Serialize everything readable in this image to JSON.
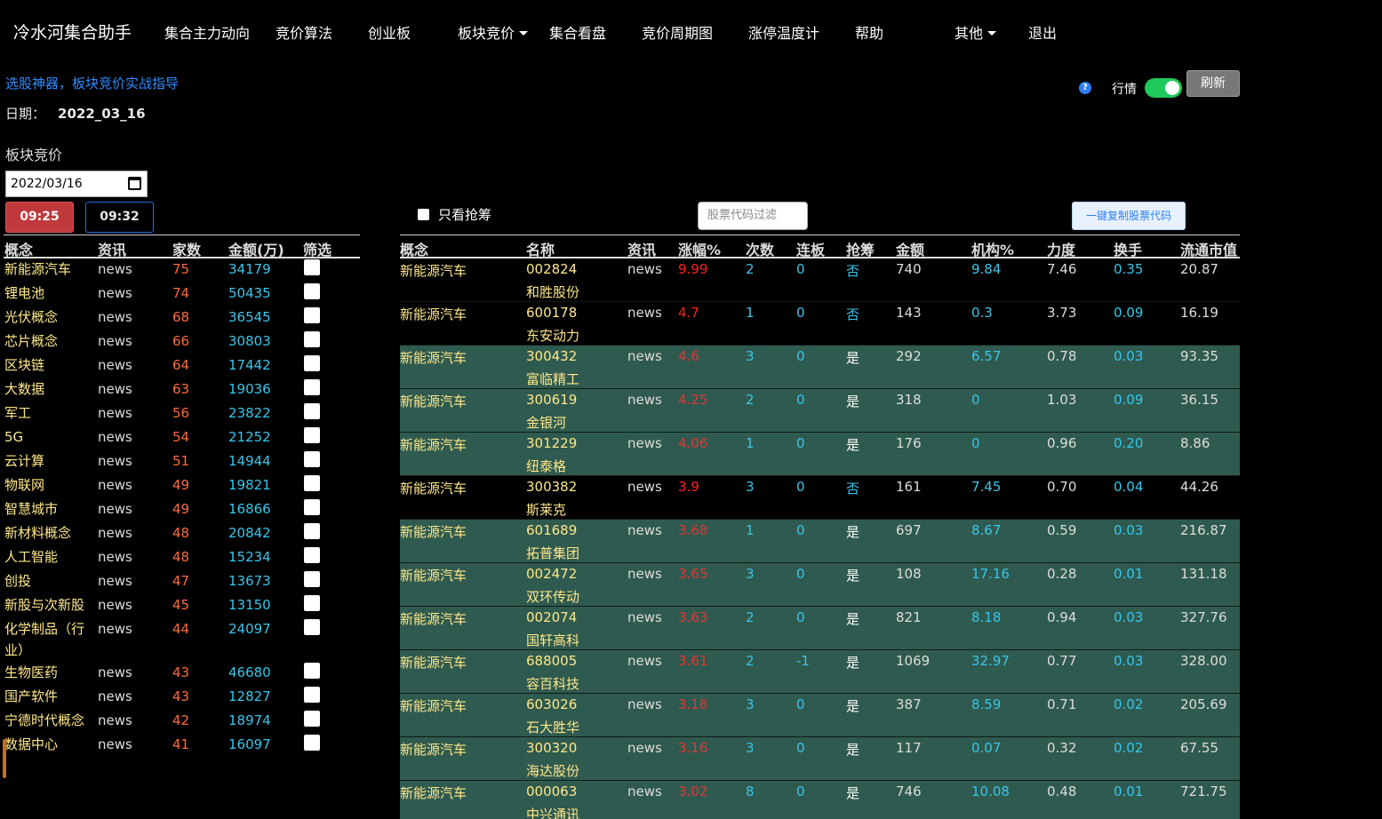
{
  "nav": {
    "brand": "冷水河集合助手",
    "items": [
      {
        "label": "集合主力动向"
      },
      {
        "label": "竞价算法"
      },
      {
        "label": "创业板"
      },
      {
        "label": "板块竞价"
      },
      {
        "label": "集合看盘"
      },
      {
        "label": "竞价周期图"
      },
      {
        "label": "涨停温度计"
      },
      {
        "label": "帮助"
      },
      {
        "label": "其他"
      },
      {
        "label": "退出"
      }
    ]
  },
  "guide_link": "选股神器，板块竞价实战指导",
  "date": {
    "label": "日期：",
    "value": "2022_03_16"
  },
  "section_title": "板块竞价",
  "toolbar": {
    "help": "?",
    "market_label": "行情",
    "market_toggle_on": true,
    "refresh_label": "刷新",
    "date_input_value": "2022/03/16",
    "time_active": "09:25",
    "time_other": "09:32",
    "only_grab_label": "只看抢筹",
    "filter_placeholder": "股票代码过滤",
    "copy_label": "一键复制股票代码"
  },
  "concept_table": {
    "headers": [
      "概念",
      "资讯",
      "家数",
      "金额(万)",
      "筛选"
    ],
    "rows": [
      {
        "name": "新能源汽车",
        "news": "news",
        "count": "75",
        "amount": "34179"
      },
      {
        "name": "锂电池",
        "news": "news",
        "count": "74",
        "amount": "50435"
      },
      {
        "name": "光伏概念",
        "news": "news",
        "count": "68",
        "amount": "36545"
      },
      {
        "name": "芯片概念",
        "news": "news",
        "count": "66",
        "amount": "30803"
      },
      {
        "name": "区块链",
        "news": "news",
        "count": "64",
        "amount": "17442"
      },
      {
        "name": "大数据",
        "news": "news",
        "count": "63",
        "amount": "19036"
      },
      {
        "name": "军工",
        "news": "news",
        "count": "56",
        "amount": "23822"
      },
      {
        "name": "5G",
        "news": "news",
        "count": "54",
        "amount": "21252"
      },
      {
        "name": "云计算",
        "news": "news",
        "count": "51",
        "amount": "14944"
      },
      {
        "name": "物联网",
        "news": "news",
        "count": "49",
        "amount": "19821"
      },
      {
        "name": "智慧城市",
        "news": "news",
        "count": "49",
        "amount": "16866"
      },
      {
        "name": "新材料概念",
        "news": "news",
        "count": "48",
        "amount": "20842"
      },
      {
        "name": "人工智能",
        "news": "news",
        "count": "48",
        "amount": "15234"
      },
      {
        "name": "创投",
        "news": "news",
        "count": "47",
        "amount": "13673"
      },
      {
        "name": "新股与次新股",
        "news": "news",
        "count": "45",
        "amount": "13150"
      },
      {
        "name": "化学制品（行业）",
        "news": "news",
        "count": "44",
        "amount": "24097"
      },
      {
        "name": "生物医药",
        "news": "news",
        "count": "43",
        "amount": "46680"
      },
      {
        "name": "国产软件",
        "news": "news",
        "count": "43",
        "amount": "12827"
      },
      {
        "name": "宁德时代概念",
        "news": "news",
        "count": "42",
        "amount": "18974"
      },
      {
        "name": "数据中心",
        "news": "news",
        "count": "41",
        "amount": "16097"
      }
    ]
  },
  "stock_table": {
    "headers": [
      "概念",
      "名称",
      "资讯",
      "涨幅%",
      "次数",
      "连板",
      "抢筹",
      "金额",
      "机构%",
      "力度",
      "换手",
      "流通市值"
    ],
    "rows": [
      {
        "concept": "新能源汽车",
        "code": "002824",
        "name": "和胜股份",
        "news": "news",
        "chg": "9.99",
        "times": "2",
        "lb": "0",
        "grab": "否",
        "amount": "740",
        "inst": "9.84",
        "force": "7.46",
        "turn": "0.35",
        "cap": "20.87"
      },
      {
        "concept": "新能源汽车",
        "code": "600178",
        "name": "东安动力",
        "news": "news",
        "chg": "4.7",
        "times": "1",
        "lb": "0",
        "grab": "否",
        "amount": "143",
        "inst": "0.3",
        "force": "3.73",
        "turn": "0.09",
        "cap": "16.19"
      },
      {
        "concept": "新能源汽车",
        "code": "300432",
        "name": "富临精工",
        "news": "news",
        "chg": "4.6",
        "times": "3",
        "lb": "0",
        "grab": "是",
        "amount": "292",
        "inst": "6.57",
        "force": "0.78",
        "turn": "0.03",
        "cap": "93.35"
      },
      {
        "concept": "新能源汽车",
        "code": "300619",
        "name": "金银河",
        "news": "news",
        "chg": "4.25",
        "times": "2",
        "lb": "0",
        "grab": "是",
        "amount": "318",
        "inst": "0",
        "force": "1.03",
        "turn": "0.09",
        "cap": "36.15"
      },
      {
        "concept": "新能源汽车",
        "code": "301229",
        "name": "纽泰格",
        "news": "news",
        "chg": "4.06",
        "times": "1",
        "lb": "0",
        "grab": "是",
        "amount": "176",
        "inst": "0",
        "force": "0.96",
        "turn": "0.20",
        "cap": "8.86"
      },
      {
        "concept": "新能源汽车",
        "code": "300382",
        "name": "斯莱克",
        "news": "news",
        "chg": "3.9",
        "times": "3",
        "lb": "0",
        "grab": "否",
        "amount": "161",
        "inst": "7.45",
        "force": "0.70",
        "turn": "0.04",
        "cap": "44.26"
      },
      {
        "concept": "新能源汽车",
        "code": "601689",
        "name": "拓普集团",
        "news": "news",
        "chg": "3.68",
        "times": "1",
        "lb": "0",
        "grab": "是",
        "amount": "697",
        "inst": "8.67",
        "force": "0.59",
        "turn": "0.03",
        "cap": "216.87"
      },
      {
        "concept": "新能源汽车",
        "code": "002472",
        "name": "双环传动",
        "news": "news",
        "chg": "3.65",
        "times": "3",
        "lb": "0",
        "grab": "是",
        "amount": "108",
        "inst": "17.16",
        "force": "0.28",
        "turn": "0.01",
        "cap": "131.18"
      },
      {
        "concept": "新能源汽车",
        "code": "002074",
        "name": "国轩高科",
        "news": "news",
        "chg": "3.63",
        "times": "2",
        "lb": "0",
        "grab": "是",
        "amount": "821",
        "inst": "8.18",
        "force": "0.94",
        "turn": "0.03",
        "cap": "327.76"
      },
      {
        "concept": "新能源汽车",
        "code": "688005",
        "name": "容百科技",
        "news": "news",
        "chg": "3.61",
        "times": "2",
        "lb": "-1",
        "grab": "是",
        "amount": "1069",
        "inst": "32.97",
        "force": "0.77",
        "turn": "0.03",
        "cap": "328.00"
      },
      {
        "concept": "新能源汽车",
        "code": "603026",
        "name": "石大胜华",
        "news": "news",
        "chg": "3.18",
        "times": "3",
        "lb": "0",
        "grab": "是",
        "amount": "387",
        "inst": "8.59",
        "force": "0.71",
        "turn": "0.02",
        "cap": "205.69"
      },
      {
        "concept": "新能源汽车",
        "code": "300320",
        "name": "海达股份",
        "news": "news",
        "chg": "3.16",
        "times": "3",
        "lb": "0",
        "grab": "是",
        "amount": "117",
        "inst": "0.07",
        "force": "0.32",
        "turn": "0.02",
        "cap": "67.55"
      },
      {
        "concept": "新能源汽车",
        "code": "000063",
        "name": "中兴通讯",
        "news": "news",
        "chg": "3.02",
        "times": "8",
        "lb": "0",
        "grab": "是",
        "amount": "746",
        "inst": "10.08",
        "force": "0.48",
        "turn": "0.01",
        "cap": "721.75"
      }
    ]
  },
  "colors": {
    "background": "#000000",
    "grab_row": "#2f5a4f",
    "concept_text": "#ffe88a",
    "count_orange": "#ff6a3a",
    "cyan": "#38c6ea",
    "red_change": "#ff2020",
    "link_blue": "#2f8cff",
    "toggle_green": "#1fc95b",
    "active_time": "#c0393c"
  }
}
